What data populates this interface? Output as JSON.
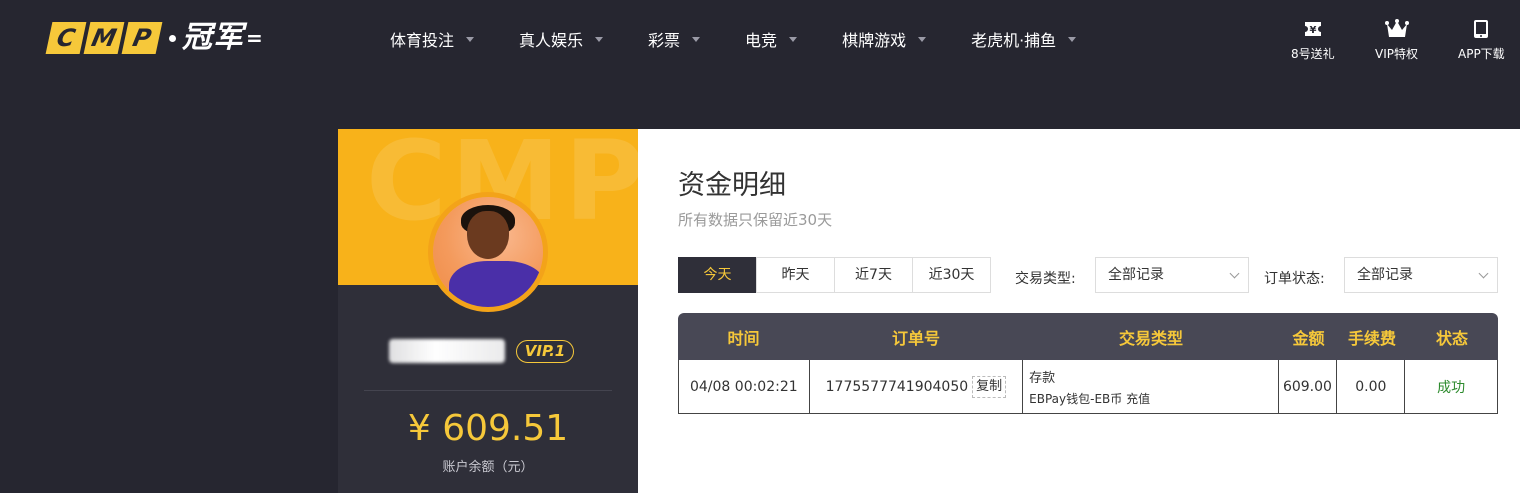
{
  "logo": {
    "brand_letters": [
      "C",
      "M",
      "P"
    ],
    "cn": "冠军",
    "tail": "="
  },
  "nav": [
    {
      "label": "体育投注"
    },
    {
      "label": "真人娱乐"
    },
    {
      "label": "彩票"
    },
    {
      "label": "电竞"
    },
    {
      "label": "棋牌游戏"
    },
    {
      "label": "老虎机·捕鱼"
    }
  ],
  "quick_links": [
    {
      "label": "8号送礼",
      "icon": "ticket-icon"
    },
    {
      "label": "VIP特权",
      "icon": "crown-icon"
    },
    {
      "label": "APP下载",
      "icon": "tablet-icon"
    }
  ],
  "profile": {
    "watermark": "CMP",
    "vip_level": "VIP.1",
    "balance": "¥ 609.51",
    "balance_label": "账户余额（元）"
  },
  "panel": {
    "title": "资金明细",
    "subtitle": "所有数据只保留近30天",
    "range_tabs": [
      "今天",
      "昨天",
      "近7天",
      "近30天"
    ],
    "active_tab": "今天",
    "type_filter": {
      "label": "交易类型:",
      "value": "全部记录"
    },
    "status_filter": {
      "label": "订单状态:",
      "value": "全部记录"
    }
  },
  "table": {
    "headers": [
      "时间",
      "订单号",
      "交易类型",
      "金额",
      "手续费",
      "状态"
    ],
    "rows": [
      {
        "time": "04/08 00:02:21",
        "order_no": "1775577741904050",
        "copy_label": "复制",
        "type_main": "存款",
        "type_sub": "EBPay钱包-EB币 充值",
        "amount": "609.00",
        "fee": "0.00",
        "status": "成功"
      }
    ]
  },
  "colors": {
    "accent": "#f6c83a",
    "dark": "#262630",
    "success": "#2e8b2e"
  }
}
